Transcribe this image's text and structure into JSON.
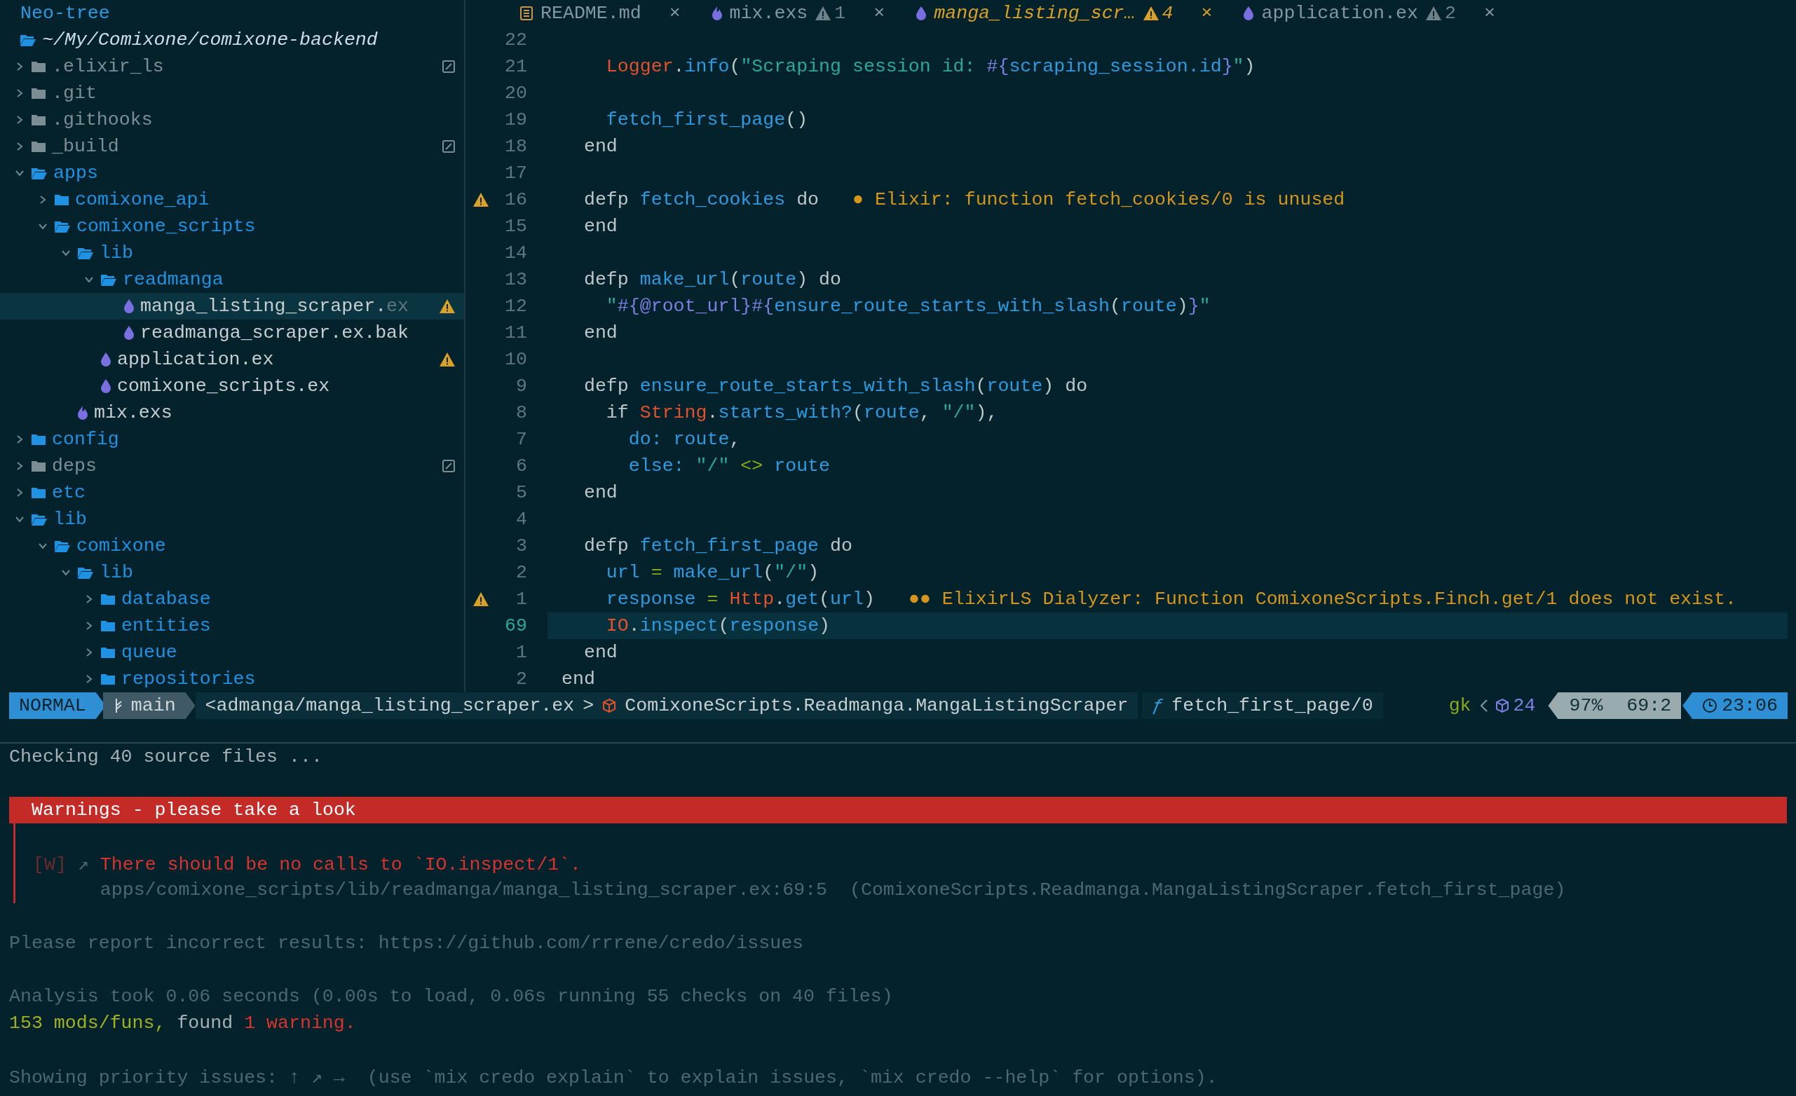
{
  "sidebar": {
    "title": "Neo-tree",
    "root": "~/My/Comixone/comixone-backend",
    "items": [
      {
        "name": ".elixir_ls",
        "kind": "folder",
        "expanded": false,
        "hidden": true,
        "ignored": true
      },
      {
        "name": ".git",
        "kind": "folder",
        "expanded": false,
        "hidden": true
      },
      {
        "name": ".githooks",
        "kind": "folder",
        "expanded": false,
        "hidden": true
      },
      {
        "name": "_build",
        "kind": "folder",
        "expanded": false,
        "hidden": true,
        "ignored": true
      },
      {
        "name": "apps",
        "kind": "folder",
        "expanded": true,
        "children": [
          {
            "name": "comixone_api",
            "kind": "folder",
            "expanded": false
          },
          {
            "name": "comixone_scripts",
            "kind": "folder",
            "expanded": true,
            "children": [
              {
                "name": "lib",
                "kind": "folder",
                "expanded": true,
                "children": [
                  {
                    "name": "readmanga",
                    "kind": "folder",
                    "expanded": true,
                    "children": [
                      {
                        "name": "manga_listing_scraper.",
                        "suffix": "ex",
                        "kind": "elixir",
                        "selected": true,
                        "warning": true
                      },
                      {
                        "name": "readmanga_scraper.ex.bak",
                        "kind": "elixir",
                        "selected": false
                      }
                    ]
                  },
                  {
                    "name": "application.ex",
                    "kind": "elixir",
                    "selected": false,
                    "warning": true
                  },
                  {
                    "name": "comixone_scripts.ex",
                    "kind": "elixir",
                    "selected": false
                  }
                ]
              },
              {
                "name": "mix.exs",
                "kind": "mix",
                "selected": false
              }
            ]
          }
        ]
      },
      {
        "name": "config",
        "kind": "folder",
        "expanded": false
      },
      {
        "name": "deps",
        "kind": "folder",
        "expanded": false,
        "hidden": true,
        "ignored": true
      },
      {
        "name": "etc",
        "kind": "folder",
        "expanded": false
      },
      {
        "name": "lib",
        "kind": "folder",
        "expanded": true,
        "children": [
          {
            "name": "comixone",
            "kind": "folder",
            "expanded": true,
            "children": [
              {
                "name": "lib",
                "kind": "folder",
                "expanded": true,
                "children": [
                  {
                    "name": "database",
                    "kind": "folder",
                    "expanded": false
                  },
                  {
                    "name": "entities",
                    "kind": "folder",
                    "expanded": false
                  },
                  {
                    "name": "queue",
                    "kind": "folder",
                    "expanded": false
                  },
                  {
                    "name": "repositories",
                    "kind": "folder",
                    "expanded": false
                  }
                ]
              }
            ]
          }
        ]
      }
    ]
  },
  "tabs": [
    {
      "name": "README.md",
      "kind": "readme",
      "selected": false,
      "close": "×"
    },
    {
      "name": "mix.exs",
      "kind": "mix",
      "selected": false,
      "warnings": "1",
      "close": "×"
    },
    {
      "name": "manga_listing_scr…",
      "kind": "elixir",
      "selected": true,
      "warnings": "4",
      "close": "×"
    },
    {
      "name": "application.ex",
      "kind": "elixir",
      "selected": false,
      "warnings": "2",
      "close": "×"
    }
  ],
  "editor": {
    "lines": [
      {
        "number": "22",
        "current": false
      },
      {
        "number": "21",
        "current": false,
        "tokens": [
          {
            "t": "    Logger",
            "kind": "mod"
          },
          {
            "t": "."
          },
          {
            "t": "info",
            "kind": "fn"
          },
          {
            "t": "("
          },
          {
            "t": "\"Scraping session id: ",
            "kind": "str"
          },
          {
            "t": "#{",
            "kind": "interp"
          },
          {
            "t": "scraping_session.id",
            "kind": "fn"
          },
          {
            "t": "}",
            "kind": "interp"
          },
          {
            "t": "\"",
            "kind": "str"
          },
          {
            "t": ")"
          }
        ]
      },
      {
        "number": "20",
        "current": false
      },
      {
        "number": "19",
        "current": false,
        "tokens": [
          {
            "t": "    fetch_first_page",
            "kind": "fn"
          },
          {
            "t": "()"
          }
        ]
      },
      {
        "number": "18",
        "current": false,
        "tokens": [
          {
            "t": "  end"
          }
        ]
      },
      {
        "number": "17",
        "current": false
      },
      {
        "number": "16",
        "current": false,
        "warning": true,
        "tokens": [
          {
            "t": "  defp "
          },
          {
            "t": "fetch_cookies",
            "kind": "fn"
          },
          {
            "t": " do"
          }
        ],
        "diagnostic": {
          "marker": "●",
          "text": "Elixir: function fetch_cookies/0 is unused"
        }
      },
      {
        "number": "15",
        "current": false,
        "tokens": [
          {
            "t": "  end"
          }
        ]
      },
      {
        "number": "14",
        "current": false
      },
      {
        "number": "13",
        "current": false,
        "tokens": [
          {
            "t": "  defp "
          },
          {
            "t": "make_url",
            "kind": "fn"
          },
          {
            "t": "("
          },
          {
            "t": "route",
            "kind": "fn"
          },
          {
            "t": ") do"
          }
        ]
      },
      {
        "number": "12",
        "current": false,
        "tokens": [
          {
            "t": "    \"",
            "kind": "str"
          },
          {
            "t": "#{@root_url}#{",
            "kind": "interp"
          },
          {
            "t": "ensure_route_starts_with_slash",
            "kind": "fn"
          },
          {
            "t": "("
          },
          {
            "t": "route",
            "kind": "fn"
          },
          {
            "t": ")"
          },
          {
            "t": "}",
            "kind": "interp"
          },
          {
            "t": "\"",
            "kind": "str"
          }
        ]
      },
      {
        "number": "11",
        "current": false,
        "tokens": [
          {
            "t": "  end"
          }
        ]
      },
      {
        "number": "10",
        "current": false
      },
      {
        "number": "9",
        "current": false,
        "tokens": [
          {
            "t": "  defp "
          },
          {
            "t": "ensure_route_starts_with_slash",
            "kind": "fn"
          },
          {
            "t": "("
          },
          {
            "t": "route",
            "kind": "fn"
          },
          {
            "t": ") do"
          }
        ]
      },
      {
        "number": "8",
        "current": false,
        "tokens": [
          {
            "t": "    if "
          },
          {
            "t": "String",
            "kind": "mod"
          },
          {
            "t": "."
          },
          {
            "t": "starts_with?",
            "kind": "fn"
          },
          {
            "t": "("
          },
          {
            "t": "route",
            "kind": "fn"
          },
          {
            "t": ", "
          },
          {
            "t": "\"/\"",
            "kind": "str"
          },
          {
            "t": "),"
          }
        ]
      },
      {
        "number": "7",
        "current": false,
        "tokens": [
          {
            "t": "      do: route",
            "kind": "fn"
          },
          {
            "t": ","
          }
        ]
      },
      {
        "number": "6",
        "current": false,
        "tokens": [
          {
            "t": "      else:",
            "kind": "fn"
          },
          {
            "t": " \"/\" ",
            "kind": "str"
          },
          {
            "t": "<>",
            "kind": "op"
          },
          {
            "t": " route",
            "kind": "fn"
          }
        ]
      },
      {
        "number": "5",
        "current": false,
        "tokens": [
          {
            "t": "  end"
          }
        ]
      },
      {
        "number": "4",
        "current": false
      },
      {
        "number": "3",
        "current": false,
        "tokens": [
          {
            "t": "  defp "
          },
          {
            "t": "fetch_first_page",
            "kind": "fn"
          },
          {
            "t": " do"
          }
        ]
      },
      {
        "number": "2",
        "current": false,
        "tokens": [
          {
            "t": "    url",
            "kind": "fn"
          },
          {
            "t": " = ",
            "kind": "op"
          },
          {
            "t": "make_url",
            "kind": "fn"
          },
          {
            "t": "("
          },
          {
            "t": "\"/\"",
            "kind": "str"
          },
          {
            "t": ")"
          }
        ]
      },
      {
        "number": "1",
        "current": false,
        "warning": true,
        "tokens": [
          {
            "t": "    response",
            "kind": "fn"
          },
          {
            "t": " = ",
            "kind": "op"
          },
          {
            "t": "Http",
            "kind": "mod"
          },
          {
            "t": "."
          },
          {
            "t": "get",
            "kind": "fn"
          },
          {
            "t": "("
          },
          {
            "t": "url",
            "kind": "fn"
          },
          {
            "t": ")"
          }
        ],
        "diagnostic": {
          "marker": "●●",
          "text": "ElixirLS Dialyzer: Function ComixoneScripts.Finch.get/1 does not exist."
        }
      },
      {
        "number": "69",
        "current": true,
        "tokens": [
          {
            "t": "    IO",
            "kind": "mod"
          },
          {
            "t": "."
          },
          {
            "t": "inspect",
            "kind": "fn"
          },
          {
            "t": "("
          },
          {
            "t": "response",
            "kind": "fn"
          },
          {
            "t": ")"
          }
        ]
      },
      {
        "number": "1",
        "current": false,
        "tokens": [
          {
            "t": "  end"
          }
        ]
      },
      {
        "number": "2",
        "current": false,
        "tokens": [
          {
            "t": "end"
          }
        ]
      }
    ]
  },
  "status_bar": {
    "mode": "NORMAL",
    "branch": "main",
    "path": "<admanga/manga_listing_scraper.ex",
    "separator": ">",
    "module": "ComixoneScripts.Readmanga.MangaListingScraper",
    "func_glyph": "ƒ",
    "function": "fetch_first_page/0",
    "gk": "gk",
    "count": "24",
    "percent": "97%",
    "position": "69:2",
    "time": "23:06"
  },
  "terminal": {
    "lines": [
      {
        "kind": "text",
        "segments": [
          {
            "t": "Checking 40 source files ...",
            "kind": "plain"
          }
        ]
      },
      {
        "kind": "blank"
      },
      {
        "kind": "banner",
        "segments": [
          {
            "t": "Warnings - please take a look",
            "kind": "banner"
          }
        ]
      },
      {
        "kind": "issue_blank"
      },
      {
        "kind": "issue",
        "segments": [
          {
            "t": "[W]",
            "kind": "darkred"
          },
          {
            "t": " ↗ ",
            "kind": "dim"
          },
          {
            "t": "There should be no calls to `IO.inspect/1`.",
            "kind": "red"
          }
        ]
      },
      {
        "kind": "issue",
        "segments": [
          {
            "t": "      apps/comixone_scripts/lib/readmanga/manga_listing_scraper.ex:69:5  (ComixoneScripts.Readmanga.MangaListingScraper.fetch_first_page)",
            "kind": "dim"
          }
        ]
      },
      {
        "kind": "blank"
      },
      {
        "kind": "text",
        "segments": [
          {
            "t": "Please report incorrect results: https://github.com/rrrene/credo/issues",
            "kind": "dim"
          }
        ]
      },
      {
        "kind": "blank"
      },
      {
        "kind": "text",
        "segments": [
          {
            "t": "Analysis took 0.06 seconds (0.00s to load, 0.06s running 55 checks on 40 files)",
            "kind": "dim"
          }
        ]
      },
      {
        "kind": "text",
        "segments": [
          {
            "t": "153 mods/funs,",
            "kind": "green"
          },
          {
            "t": " found ",
            "kind": "plain"
          },
          {
            "t": "1 warning.",
            "kind": "red"
          }
        ]
      },
      {
        "kind": "blank"
      },
      {
        "kind": "text",
        "segments": [
          {
            "t": "Showing priority issues: ↑ ↗ →  (use `mix credo explain` to explain issues, `mix credo --help` for options).",
            "kind": "dim"
          }
        ]
      }
    ]
  }
}
